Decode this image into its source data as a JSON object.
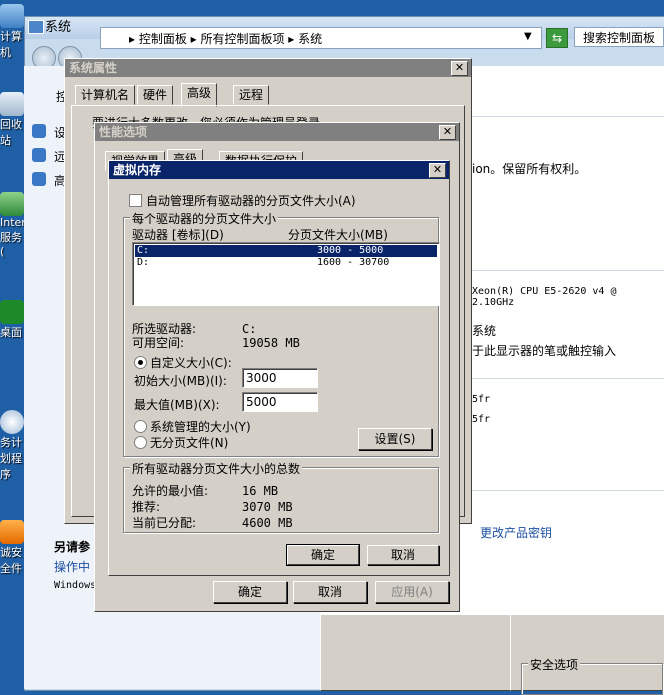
{
  "desktop": {
    "icons": [
      {
        "label": "计算机",
        "name": "computer-desktop-icon"
      },
      {
        "label": "回收站",
        "name": "recycle-bin-desktop-icon"
      },
      {
        "label": "Internet 服务 (",
        "name": "internet-services-desktop-icon"
      },
      {
        "label": "桌面",
        "name": "desktop-shortcut-icon"
      },
      {
        "label": "务计划程序",
        "name": "task-scheduler-desktop-icon"
      },
      {
        "label": "诚安全件",
        "name": "security-software-desktop-icon"
      }
    ]
  },
  "control_panel": {
    "title": "系统",
    "breadcrumb": "▸ 控制面板 ▸ 所有控制面板项 ▸ 系统",
    "search_placeholder": "搜索控制面板",
    "left_items": [
      "控",
      "设",
      "远",
      "高"
    ],
    "see_also": {
      "heading": "另请参",
      "item": "操作中",
      "item2": "Windows"
    },
    "right_text": {
      "copyright": "ion。保留所有权利。",
      "cpu": "Xeon(R) CPU E5-2620 v4 @ 2.10GHz",
      "system": "系统",
      "pen": "于此显示器的笔或触控输入",
      "frag1": "5fr",
      "frag2": "5fr",
      "change_key": "更改产品密钥",
      "security": "安全选项"
    }
  },
  "sys_props": {
    "title": "系统属性",
    "tabs": [
      "计算机名",
      "硬件",
      "高级",
      "远程"
    ],
    "hidden_text": "要进行大多数更改，您必须作为管理员登录。",
    "buttons": {
      "ok": "确定",
      "cancel": "取消",
      "apply": "应用(A)"
    }
  },
  "perf_options": {
    "title": "性能选项",
    "tabs": [
      "视觉效果",
      "高级",
      "数据执行保护"
    ]
  },
  "virtual_memory": {
    "title": "虚拟内存",
    "auto_manage": "自动管理所有驱动器的分页文件大小(A)",
    "auto_manage_checked": false,
    "group1_title": "每个驱动器的分页文件大小",
    "col_drive": "驱动器 [卷标](D)",
    "col_size": "分页文件大小(MB)",
    "drives": [
      {
        "drive": "C:",
        "size": "3000 - 5000",
        "selected": true
      },
      {
        "drive": "D:",
        "size": "1600 - 30700",
        "selected": false
      }
    ],
    "selected_drive_label": "所选驱动器:",
    "selected_drive_value": "C:",
    "free_space_label": "可用空间:",
    "free_space_value": "19058 MB",
    "custom_size": "自定义大小(C):",
    "initial_label": "初始大小(MB)(I):",
    "initial_value": "3000",
    "max_label": "最大值(MB)(X):",
    "max_value": "5000",
    "system_managed": "系统管理的大小(Y)",
    "no_paging": "无分页文件(N)",
    "set_button": "设置(S)",
    "group2_title": "所有驱动器分页文件大小的总数",
    "min_label": "允许的最小值:",
    "min_value": "16 MB",
    "recommended_label": "推荐:",
    "recommended_value": "3070 MB",
    "allocated_label": "当前已分配:",
    "allocated_value": "4600 MB",
    "ok": "确定",
    "cancel": "取消"
  }
}
